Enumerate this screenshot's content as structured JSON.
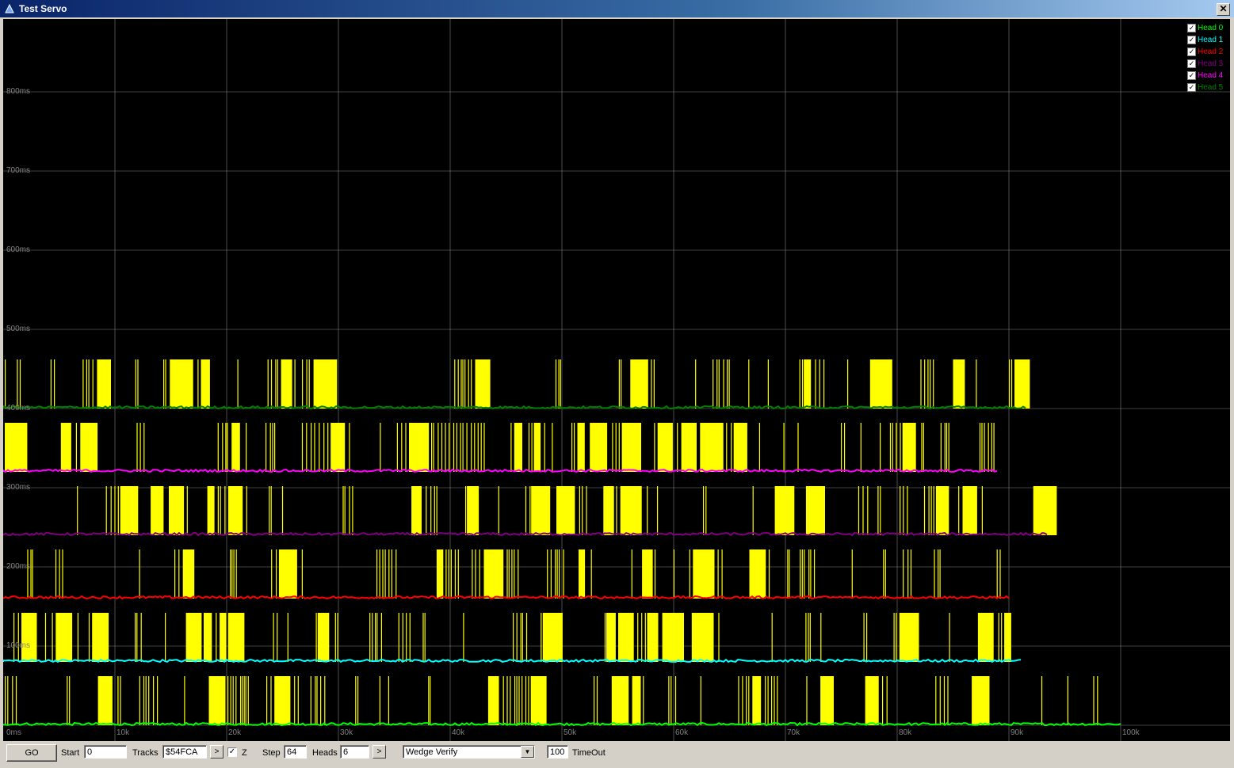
{
  "window": {
    "title": "Test Servo",
    "close_glyph": "✕"
  },
  "chart_data": {
    "type": "line",
    "y_ticks": [
      "800ms",
      "700ms",
      "600ms",
      "500ms",
      "400ms",
      "300ms",
      "200ms",
      "100ms",
      "0ms"
    ],
    "x_ticks": [
      "10k",
      "20k",
      "30k",
      "40k",
      "50k",
      "60k",
      "70k",
      "80k",
      "90k",
      "100k"
    ],
    "xlim": [
      0,
      110000
    ],
    "ylim": [
      0,
      900
    ],
    "grid": true,
    "spike_color": "#ffff00",
    "series": [
      {
        "name": "Head 0",
        "color": "#00ff00",
        "baseline_ms": 0,
        "end_x": 100000
      },
      {
        "name": "Head 1",
        "color": "#00ffff",
        "baseline_ms": 80,
        "end_x": 91000
      },
      {
        "name": "Head 2",
        "color": "#ff0000",
        "baseline_ms": 160,
        "end_x": 90000
      },
      {
        "name": "Head 3",
        "color": "#800080",
        "baseline_ms": 240,
        "end_x": 93500
      },
      {
        "name": "Head 4",
        "color": "#ff00ff",
        "baseline_ms": 320,
        "end_x": 89000
      },
      {
        "name": "Head 5",
        "color": "#008000",
        "baseline_ms": 400,
        "end_x": 91500
      }
    ],
    "legend_position": "top-right"
  },
  "toolbar": {
    "go_label": "GO",
    "start_label": "Start",
    "start_value": "0",
    "tracks_label": "Tracks",
    "tracks_value": "$54FCA",
    "tracks_arrow": ">",
    "z_label": "Z",
    "z_checked": "✓",
    "step_label": "Step",
    "step_value": "64",
    "heads_label": "Heads",
    "heads_value": "6",
    "heads_arrow": ">",
    "mode_value": "Wedge Verify",
    "mode_arrow": "▼",
    "timeout_value": "100",
    "timeout_label": "TimeOut"
  },
  "legend_check": "✓"
}
